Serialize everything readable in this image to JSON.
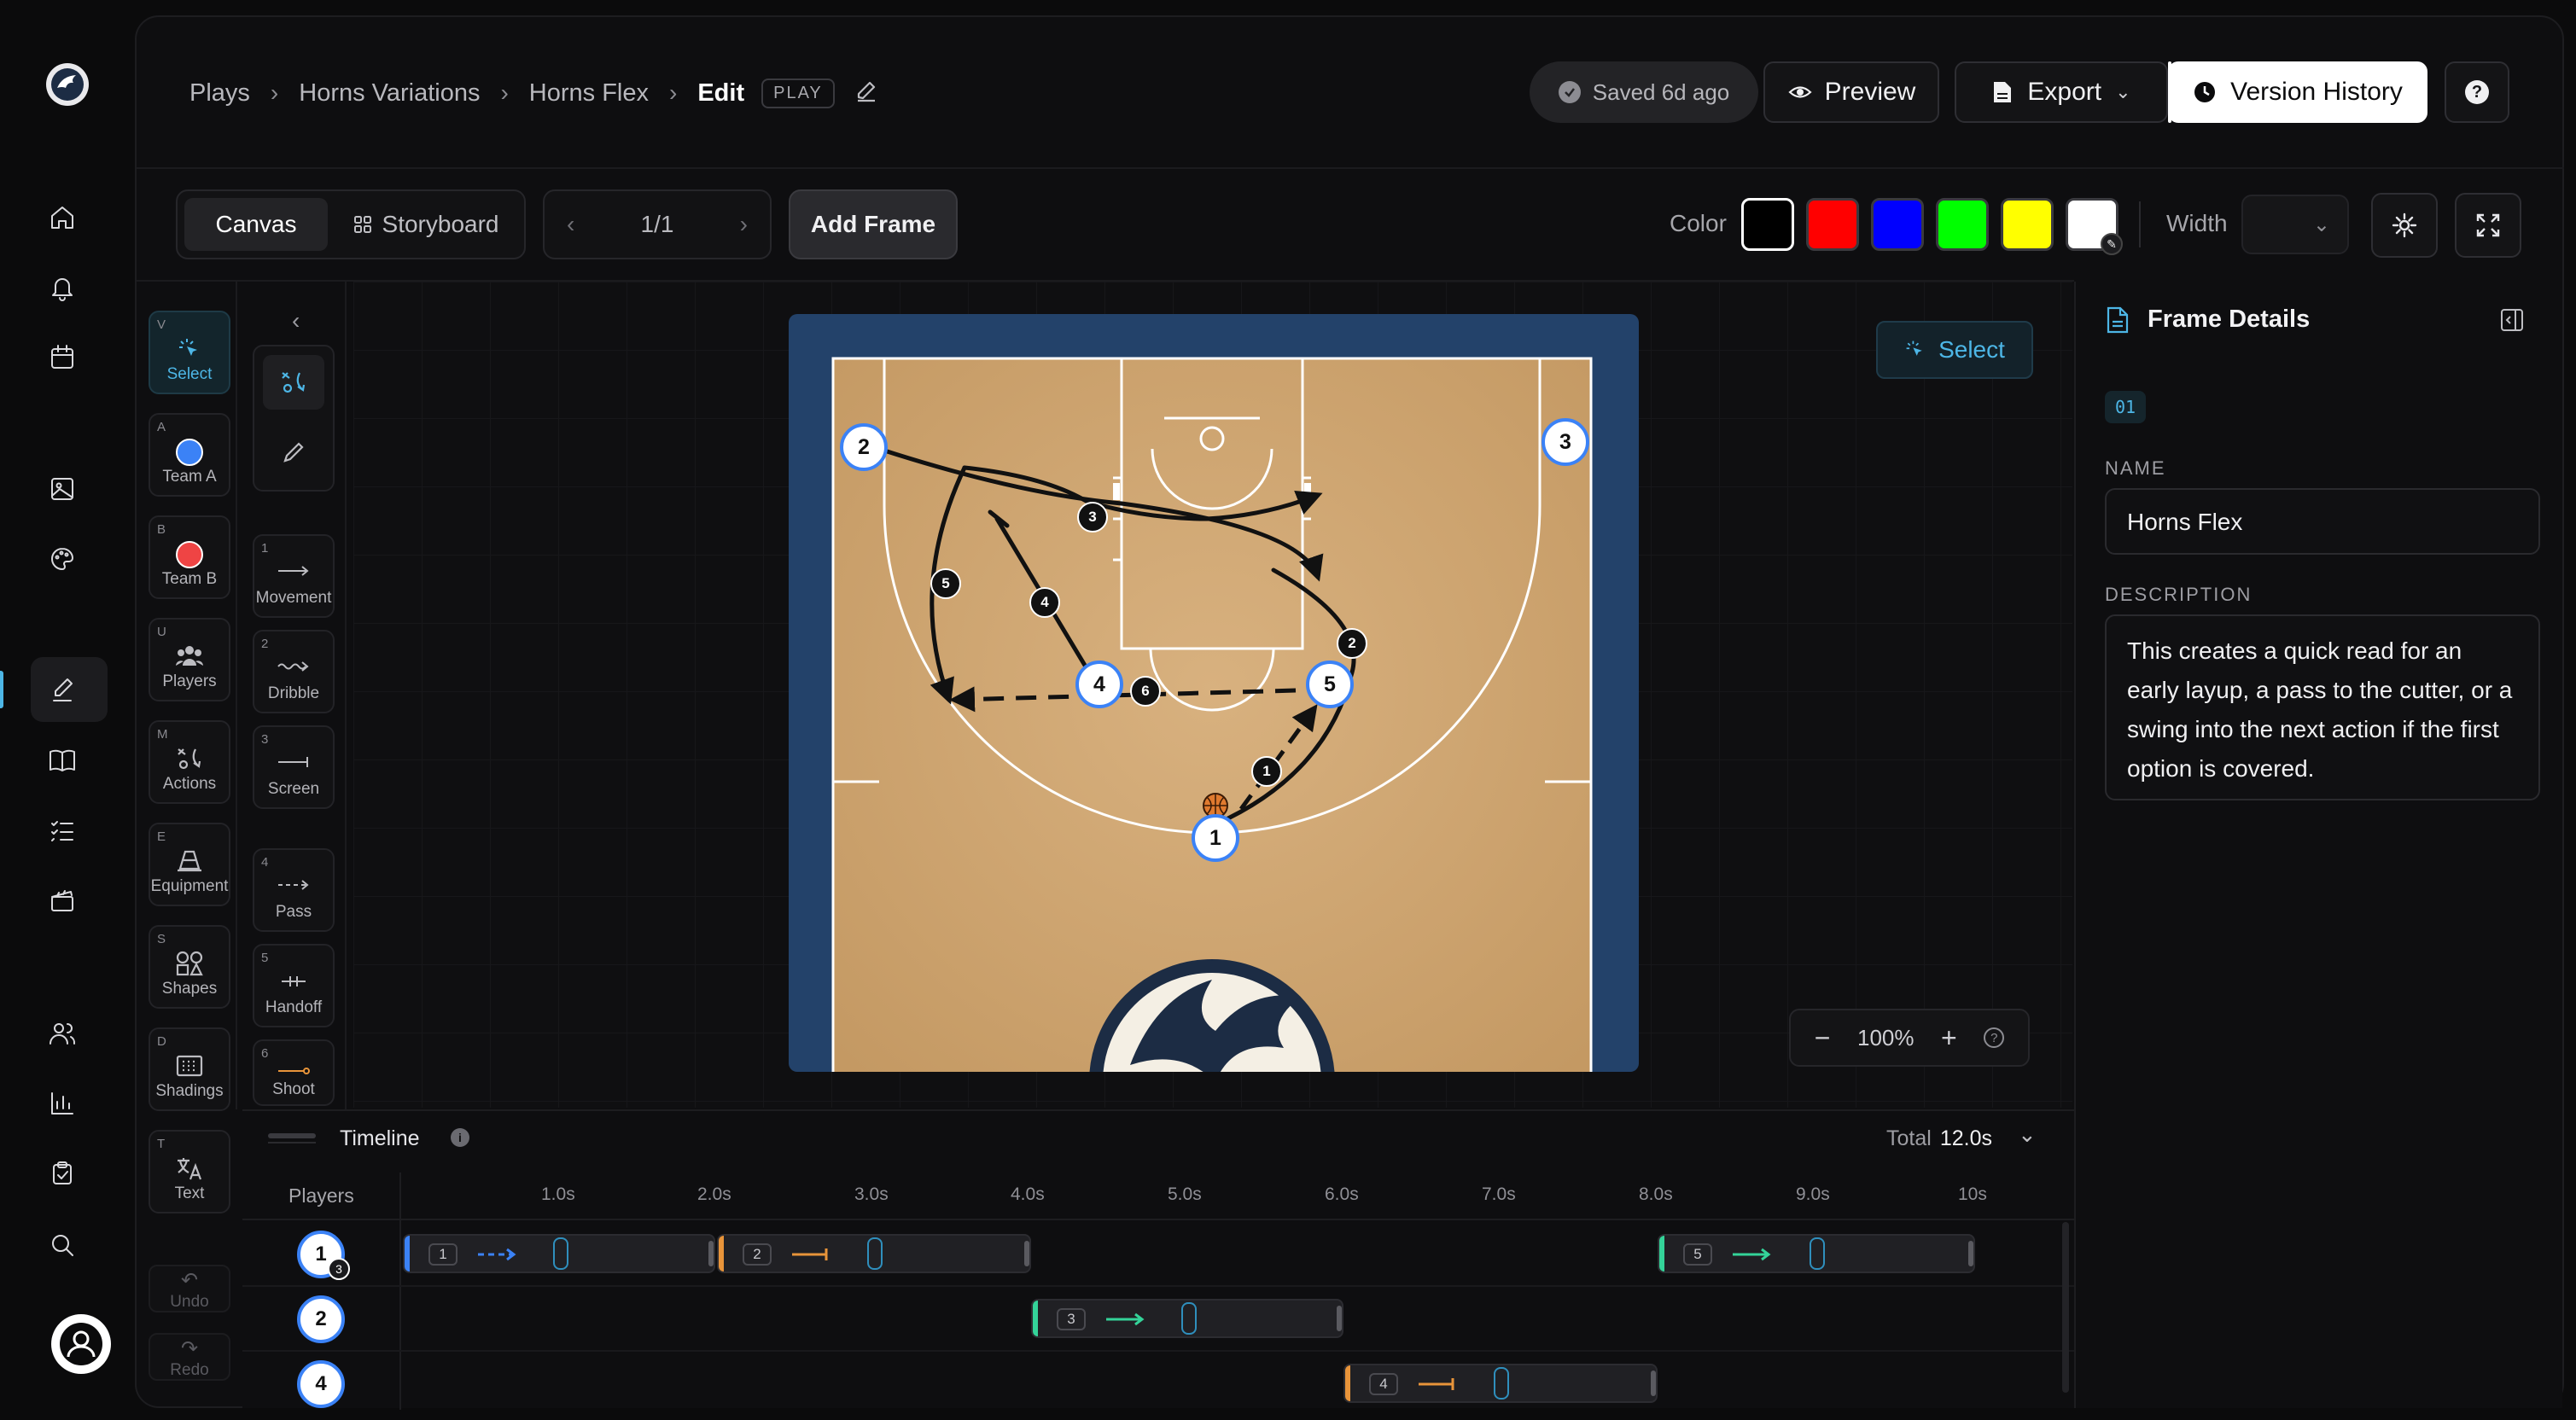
{
  "breadcrumb": {
    "items": [
      "Plays",
      "Horns Variations",
      "Horns Flex"
    ],
    "current": "Edit",
    "tag": "PLAY"
  },
  "header": {
    "saved": "Saved 6d ago",
    "preview": "Preview",
    "export": "Export",
    "version_history": "Version History",
    "help": "?"
  },
  "toolbar": {
    "canvas": "Canvas",
    "storyboard": "Storyboard",
    "pager": "1/1",
    "add_frame": "Add Frame",
    "color_label": "Color",
    "width_label": "Width",
    "colors": [
      "#000000",
      "#ff0000",
      "#0000ff",
      "#00ff00",
      "#ffff00",
      "#ffffff"
    ]
  },
  "tools": [
    {
      "key": "V",
      "label": "Select"
    },
    {
      "key": "A",
      "label": "Team A"
    },
    {
      "key": "B",
      "label": "Team B"
    },
    {
      "key": "U",
      "label": "Players"
    },
    {
      "key": "M",
      "label": "Actions"
    },
    {
      "key": "E",
      "label": "Equipment"
    },
    {
      "key": "S",
      "label": "Shapes"
    },
    {
      "key": "D",
      "label": "Shadings"
    },
    {
      "key": "T",
      "label": "Text"
    }
  ],
  "history": {
    "undo": "Undo",
    "redo": "Redo"
  },
  "actions": [
    {
      "key": "1",
      "label": "Movement"
    },
    {
      "key": "2",
      "label": "Dribble"
    },
    {
      "key": "3",
      "label": "Screen"
    },
    {
      "key": "4",
      "label": "Pass"
    },
    {
      "key": "5",
      "label": "Handoff"
    },
    {
      "key": "6",
      "label": "Shoot"
    }
  ],
  "canvas": {
    "select_label": "Select",
    "zoom": "100%",
    "players": [
      "2",
      "3",
      "4",
      "5",
      "1"
    ],
    "action_numbers": [
      "1",
      "2",
      "3",
      "4",
      "5",
      "6"
    ]
  },
  "panel": {
    "title": "Frame Details",
    "frame_id": "01",
    "name_label": "NAME",
    "name_value": "Horns Flex",
    "description_label": "DESCRIPTION",
    "description_value": "This creates a quick read for an early layup, a pass to the cutter, or a swing into the next action if the first option is covered."
  },
  "timeline": {
    "title": "Timeline",
    "total_label": "Total",
    "total_value": "12.0s",
    "players_header": "Players",
    "ticks": [
      "1.0s",
      "2.0s",
      "3.0s",
      "4.0s",
      "5.0s",
      "6.0s",
      "7.0s",
      "8.0s",
      "9.0s",
      "10s"
    ],
    "rows": [
      {
        "player": "1",
        "badge": "3",
        "clips": [
          "1",
          "2",
          "5"
        ]
      },
      {
        "player": "2",
        "clips": [
          "3"
        ]
      },
      {
        "player": "4",
        "clips": [
          "4"
        ]
      }
    ]
  }
}
